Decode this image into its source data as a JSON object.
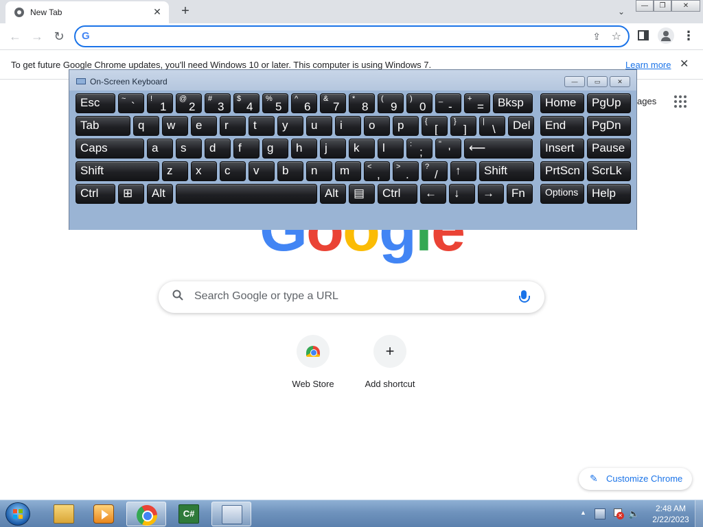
{
  "browser": {
    "tab": {
      "title": "New Tab",
      "close": "✕"
    },
    "new_tab": "+",
    "tab_search": "⌄",
    "window_buttons": {
      "minimize": "—",
      "restore": "❐",
      "close": "✕"
    },
    "nav": {
      "back": "←",
      "forward": "→",
      "reload": "↻"
    },
    "omnibox": {
      "g_logo": "G",
      "value": "",
      "share": "⇪",
      "star": "☆"
    },
    "menu": "⋮"
  },
  "infobar": {
    "text": "To get future Google Chrome updates, you'll need Windows 10 or later. This computer is using Windows 7.",
    "link": "Learn more",
    "close": "✕"
  },
  "ntp": {
    "apps_text": "ages",
    "logo": [
      "G",
      "o",
      "o",
      "g",
      "l",
      "e"
    ],
    "logo_colors": [
      "#4285f4",
      "#ea4335",
      "#fbbc05",
      "#4285f4",
      "#34a853",
      "#ea4335"
    ],
    "search": {
      "placeholder": "Search Google or type a URL",
      "icon": "🔍"
    },
    "shortcuts": [
      {
        "label": "Web Store",
        "icon": "web-store"
      },
      {
        "label": "Add shortcut",
        "icon": "+"
      }
    ],
    "customize": {
      "label": "Customize Chrome",
      "icon": "✎"
    }
  },
  "osk": {
    "title": "On-Screen Keyboard",
    "buttons": {
      "minimize": "—",
      "restore": "▭",
      "close": "✕"
    },
    "rows": [
      [
        {
          "main": "Esc",
          "w": 58
        },
        {
          "shift": "~",
          "base": "`",
          "w": 38
        },
        {
          "shift": "!",
          "base": "1",
          "w": 38
        },
        {
          "shift": "@",
          "base": "2",
          "w": 38
        },
        {
          "shift": "#",
          "base": "3",
          "w": 38
        },
        {
          "shift": "$",
          "base": "4",
          "w": 38
        },
        {
          "shift": "%",
          "base": "5",
          "w": 38
        },
        {
          "shift": "^",
          "base": "6",
          "w": 38
        },
        {
          "shift": "&",
          "base": "7",
          "w": 38
        },
        {
          "shift": "*",
          "base": "8",
          "w": 38
        },
        {
          "shift": "(",
          "base": "9",
          "w": 38
        },
        {
          "shift": ")",
          "base": "0",
          "w": 38
        },
        {
          "shift": "_",
          "base": "-",
          "w": 38
        },
        {
          "shift": "+",
          "base": "=",
          "w": 38
        },
        {
          "main": "Bksp",
          "w": 58
        }
      ],
      [
        {
          "main": "Tab",
          "w": 80
        },
        {
          "main": "q",
          "w": 38
        },
        {
          "main": "w",
          "w": 38
        },
        {
          "main": "e",
          "w": 38
        },
        {
          "main": "r",
          "w": 38
        },
        {
          "main": "t",
          "w": 38
        },
        {
          "main": "y",
          "w": 38
        },
        {
          "main": "u",
          "w": 38
        },
        {
          "main": "i",
          "w": 38
        },
        {
          "main": "o",
          "w": 38
        },
        {
          "main": "p",
          "w": 38
        },
        {
          "shift": "{",
          "base": "[",
          "w": 38
        },
        {
          "shift": "}",
          "base": "]",
          "w": 38
        },
        {
          "shift": "|",
          "base": "\\",
          "w": 38
        },
        {
          "main": "Del",
          "w": 38
        }
      ],
      [
        {
          "main": "Caps",
          "w": 100
        },
        {
          "main": "a",
          "w": 38
        },
        {
          "main": "s",
          "w": 38
        },
        {
          "main": "d",
          "w": 38
        },
        {
          "main": "f",
          "w": 38
        },
        {
          "main": "g",
          "w": 38
        },
        {
          "main": "h",
          "w": 38
        },
        {
          "main": "j",
          "w": 38
        },
        {
          "main": "k",
          "w": 38
        },
        {
          "main": "l",
          "w": 38
        },
        {
          "shift": ":",
          "base": ";",
          "w": 38
        },
        {
          "shift": "\"",
          "base": "'",
          "w": 38
        },
        {
          "main": "⟵",
          "w": 100
        }
      ],
      [
        {
          "main": "Shift",
          "w": 122
        },
        {
          "main": "z",
          "w": 38
        },
        {
          "main": "x",
          "w": 38
        },
        {
          "main": "c",
          "w": 38
        },
        {
          "main": "v",
          "w": 38
        },
        {
          "main": "b",
          "w": 38
        },
        {
          "main": "n",
          "w": 38
        },
        {
          "main": "m",
          "w": 38
        },
        {
          "shift": "<",
          "base": ",",
          "w": 38
        },
        {
          "shift": ">",
          "base": ".",
          "w": 38
        },
        {
          "shift": "?",
          "base": "/",
          "w": 38
        },
        {
          "main": "↑",
          "w": 38
        },
        {
          "main": "Shift",
          "w": 80
        }
      ],
      [
        {
          "main": "Ctrl",
          "w": 58
        },
        {
          "main": "⊞",
          "w": 38
        },
        {
          "main": "Alt",
          "w": 38
        },
        {
          "main": "",
          "w": 206
        },
        {
          "main": "Alt",
          "w": 38
        },
        {
          "main": "▤",
          "w": 38
        },
        {
          "main": "Ctrl",
          "w": 58
        },
        {
          "main": "←",
          "w": 38
        },
        {
          "main": "↓",
          "w": 38
        },
        {
          "main": "→",
          "w": 38
        },
        {
          "main": "Fn",
          "w": 38
        }
      ]
    ],
    "right_rows": [
      [
        "Home",
        "PgUp"
      ],
      [
        "End",
        "PgDn"
      ],
      [
        "Insert",
        "Pause"
      ],
      [
        "PrtScn",
        "ScrLk"
      ],
      [
        "Options",
        "Help"
      ]
    ]
  },
  "taskbar": {
    "apps": [
      "start-orb",
      "explorer",
      "media-player",
      "chrome",
      "csharp-editor",
      "on-screen-keyboard"
    ],
    "active_app": "chrome",
    "tray_arrow": "▲",
    "time": "2:48 AM",
    "date": "2/22/2023"
  }
}
